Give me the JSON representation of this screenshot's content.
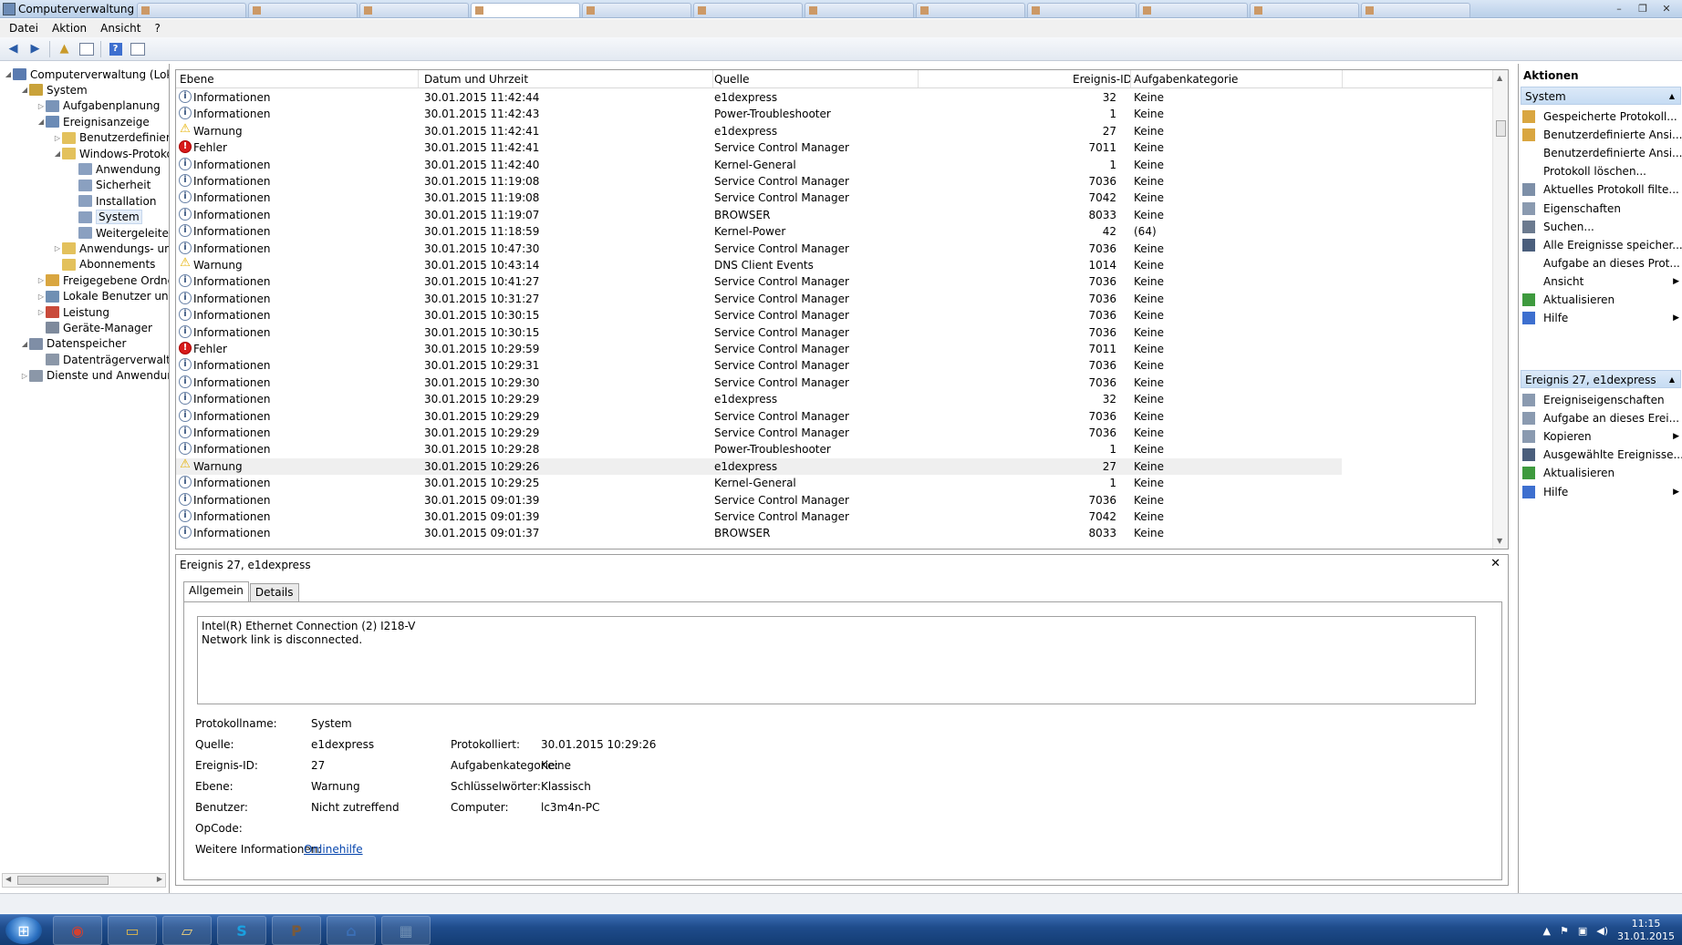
{
  "window": {
    "title": "Computerverwaltung"
  },
  "menu": [
    "Datei",
    "Aktion",
    "Ansicht",
    "?"
  ],
  "tree": [
    {
      "label": "Computerverwaltung (Lokal)",
      "icon": "computer-management-icon",
      "color": "#5a7bb0"
    },
    {
      "label": "System",
      "icon": "system-tools-icon",
      "color": "#c9a23a"
    },
    {
      "label": "Aufgabenplanung",
      "icon": "clock-icon",
      "color": "#7a94b8"
    },
    {
      "label": "Ereignisanzeige",
      "icon": "event-viewer-icon",
      "color": "#6b8bb6"
    },
    {
      "label": "Benutzerdefinierte A",
      "icon": "folder-icon",
      "color": "#e3c15c"
    },
    {
      "label": "Windows-Protokolle",
      "icon": "folder-icon",
      "color": "#e3c15c"
    },
    {
      "label": "Anwendung",
      "icon": "log-icon",
      "color": "#8aa0c0"
    },
    {
      "label": "Sicherheit",
      "icon": "log-icon",
      "color": "#8aa0c0"
    },
    {
      "label": "Installation",
      "icon": "log-icon",
      "color": "#8aa0c0"
    },
    {
      "label": "System",
      "icon": "log-icon",
      "color": "#8aa0c0"
    },
    {
      "label": "Weitergeleitete E",
      "icon": "log-icon",
      "color": "#8aa0c0"
    },
    {
      "label": "Anwendungs- und D",
      "icon": "folder-icon",
      "color": "#e3c15c"
    },
    {
      "label": "Abonnements",
      "icon": "subscriptions-icon",
      "color": "#e3c15c"
    },
    {
      "label": "Freigegebene Ordner",
      "icon": "shared-folder-icon",
      "color": "#d9a640"
    },
    {
      "label": "Lokale Benutzer und Gru",
      "icon": "users-icon",
      "color": "#6f8fb3"
    },
    {
      "label": "Leistung",
      "icon": "performance-icon",
      "color": "#c94a3a"
    },
    {
      "label": "Geräte-Manager",
      "icon": "device-manager-icon",
      "color": "#7e8a9c"
    },
    {
      "label": "Datenspeicher",
      "icon": "storage-icon",
      "color": "#7f8ea6"
    },
    {
      "label": "Datenträgerverwaltung",
      "icon": "disk-icon",
      "color": "#8b97a8"
    },
    {
      "label": "Dienste und Anwendungen",
      "icon": "services-icon",
      "color": "#8b97a8"
    }
  ],
  "grid": {
    "columns": [
      "Ebene",
      "Datum und Uhrzeit",
      "Quelle",
      "Ereignis-ID",
      "Aufgabenkategorie"
    ],
    "rows": [
      {
        "level": "Informationen",
        "type": "info",
        "date": "30.01.2015 11:42:44",
        "source": "e1dexpress",
        "id": "32",
        "cat": "Keine"
      },
      {
        "level": "Informationen",
        "type": "info",
        "date": "30.01.2015 11:42:43",
        "source": "Power-Troubleshooter",
        "id": "1",
        "cat": "Keine"
      },
      {
        "level": "Warnung",
        "type": "warn",
        "date": "30.01.2015 11:42:41",
        "source": "e1dexpress",
        "id": "27",
        "cat": "Keine"
      },
      {
        "level": "Fehler",
        "type": "err",
        "date": "30.01.2015 11:42:41",
        "source": "Service Control Manager",
        "id": "7011",
        "cat": "Keine"
      },
      {
        "level": "Informationen",
        "type": "info",
        "date": "30.01.2015 11:42:40",
        "source": "Kernel-General",
        "id": "1",
        "cat": "Keine"
      },
      {
        "level": "Informationen",
        "type": "info",
        "date": "30.01.2015 11:19:08",
        "source": "Service Control Manager",
        "id": "7036",
        "cat": "Keine"
      },
      {
        "level": "Informationen",
        "type": "info",
        "date": "30.01.2015 11:19:08",
        "source": "Service Control Manager",
        "id": "7042",
        "cat": "Keine"
      },
      {
        "level": "Informationen",
        "type": "info",
        "date": "30.01.2015 11:19:07",
        "source": "BROWSER",
        "id": "8033",
        "cat": "Keine"
      },
      {
        "level": "Informationen",
        "type": "info",
        "date": "30.01.2015 11:18:59",
        "source": "Kernel-Power",
        "id": "42",
        "cat": "(64)"
      },
      {
        "level": "Informationen",
        "type": "info",
        "date": "30.01.2015 10:47:30",
        "source": "Service Control Manager",
        "id": "7036",
        "cat": "Keine"
      },
      {
        "level": "Warnung",
        "type": "warn",
        "date": "30.01.2015 10:43:14",
        "source": "DNS Client Events",
        "id": "1014",
        "cat": "Keine"
      },
      {
        "level": "Informationen",
        "type": "info",
        "date": "30.01.2015 10:41:27",
        "source": "Service Control Manager",
        "id": "7036",
        "cat": "Keine"
      },
      {
        "level": "Informationen",
        "type": "info",
        "date": "30.01.2015 10:31:27",
        "source": "Service Control Manager",
        "id": "7036",
        "cat": "Keine"
      },
      {
        "level": "Informationen",
        "type": "info",
        "date": "30.01.2015 10:30:15",
        "source": "Service Control Manager",
        "id": "7036",
        "cat": "Keine"
      },
      {
        "level": "Informationen",
        "type": "info",
        "date": "30.01.2015 10:30:15",
        "source": "Service Control Manager",
        "id": "7036",
        "cat": "Keine"
      },
      {
        "level": "Fehler",
        "type": "err",
        "date": "30.01.2015 10:29:59",
        "source": "Service Control Manager",
        "id": "7011",
        "cat": "Keine"
      },
      {
        "level": "Informationen",
        "type": "info",
        "date": "30.01.2015 10:29:31",
        "source": "Service Control Manager",
        "id": "7036",
        "cat": "Keine"
      },
      {
        "level": "Informationen",
        "type": "info",
        "date": "30.01.2015 10:29:30",
        "source": "Service Control Manager",
        "id": "7036",
        "cat": "Keine"
      },
      {
        "level": "Informationen",
        "type": "info",
        "date": "30.01.2015 10:29:29",
        "source": "e1dexpress",
        "id": "32",
        "cat": "Keine"
      },
      {
        "level": "Informationen",
        "type": "info",
        "date": "30.01.2015 10:29:29",
        "source": "Service Control Manager",
        "id": "7036",
        "cat": "Keine"
      },
      {
        "level": "Informationen",
        "type": "info",
        "date": "30.01.2015 10:29:29",
        "source": "Service Control Manager",
        "id": "7036",
        "cat": "Keine"
      },
      {
        "level": "Informationen",
        "type": "info",
        "date": "30.01.2015 10:29:28",
        "source": "Power-Troubleshooter",
        "id": "1",
        "cat": "Keine"
      },
      {
        "level": "Warnung",
        "type": "warn",
        "date": "30.01.2015 10:29:26",
        "source": "e1dexpress",
        "id": "27",
        "cat": "Keine",
        "selected": true
      },
      {
        "level": "Informationen",
        "type": "info",
        "date": "30.01.2015 10:29:25",
        "source": "Kernel-General",
        "id": "1",
        "cat": "Keine"
      },
      {
        "level": "Informationen",
        "type": "info",
        "date": "30.01.2015 09:01:39",
        "source": "Service Control Manager",
        "id": "7036",
        "cat": "Keine"
      },
      {
        "level": "Informationen",
        "type": "info",
        "date": "30.01.2015 09:01:39",
        "source": "Service Control Manager",
        "id": "7042",
        "cat": "Keine"
      },
      {
        "level": "Informationen",
        "type": "info",
        "date": "30.01.2015 09:01:37",
        "source": "BROWSER",
        "id": "8033",
        "cat": "Keine"
      }
    ]
  },
  "detail": {
    "title": "Ereignis 27, e1dexpress",
    "tabs": [
      "Allgemein",
      "Details"
    ],
    "message_line1": "Intel(R) Ethernet Connection (2) I218-V",
    "message_line2": "Network link is disconnected.",
    "fields": {
      "protokollname_label": "Protokollname:",
      "protokollname": "System",
      "quelle_label": "Quelle:",
      "quelle": "e1dexpress",
      "protokolliert_label": "Protokolliert:",
      "protokolliert": "30.01.2015 10:29:26",
      "id_label": "Ereignis-ID:",
      "id": "27",
      "aufgabe_label": "Aufgabenkategorie:",
      "aufgabe": "Keine",
      "ebene_label": "Ebene:",
      "ebene": "Warnung",
      "schluessel_label": "Schlüsselwörter:",
      "schluessel": "Klassisch",
      "benutzer_label": "Benutzer:",
      "benutzer": "Nicht zutreffend",
      "computer_label": "Computer:",
      "computer": "lc3m4n-PC",
      "opcode_label": "OpCode:",
      "weitere_label": "Weitere Informationen:",
      "weitere_link": "Onlinehilfe"
    }
  },
  "actions": {
    "title": "Aktionen",
    "group1": "System",
    "group1_items": [
      {
        "label": "Gespeicherte Protokoll...",
        "icon": "open-log-icon",
        "color": "#d9a640",
        "submenu": false
      },
      {
        "label": "Benutzerdefinierte Ansi...",
        "icon": "filter-icon",
        "color": "#d9a640",
        "submenu": false
      },
      {
        "label": "Benutzerdefinierte Ansi...",
        "icon": "blank-icon",
        "color": "",
        "submenu": false
      },
      {
        "label": "Protokoll löschen...",
        "icon": "blank-icon",
        "color": "",
        "submenu": false
      },
      {
        "label": "Aktuelles Protokoll filte...",
        "icon": "filter-icon",
        "color": "#7d8fa8",
        "submenu": false
      },
      {
        "label": "Eigenschaften",
        "icon": "properties-icon",
        "color": "#8a9ab0",
        "submenu": false
      },
      {
        "label": "Suchen...",
        "icon": "find-icon",
        "color": "#6b7a8f",
        "submenu": false
      },
      {
        "label": "Alle Ereignisse speicher...",
        "icon": "save-icon",
        "color": "#4a5e7c",
        "submenu": false
      },
      {
        "label": "Aufgabe an dieses Prot...",
        "icon": "blank-icon",
        "color": "",
        "submenu": false
      },
      {
        "label": "Ansicht",
        "icon": "blank-icon",
        "color": "",
        "submenu": true
      },
      {
        "label": "Aktualisieren",
        "icon": "refresh-icon",
        "color": "#3e9a3e",
        "submenu": false
      },
      {
        "label": "Hilfe",
        "icon": "help-icon",
        "color": "#3d6fcf",
        "submenu": true
      }
    ],
    "group2": "Ereignis 27, e1dexpress",
    "group2_items": [
      {
        "label": "Ereigniseigenschaften",
        "icon": "properties-icon",
        "color": "#8a9ab0",
        "submenu": false
      },
      {
        "label": "Aufgabe an dieses Erei...",
        "icon": "task-icon",
        "color": "#8a9ab0",
        "submenu": false
      },
      {
        "label": "Kopieren",
        "icon": "copy-icon",
        "color": "#8a9ab0",
        "submenu": true
      },
      {
        "label": "Ausgewählte Ereignisse...",
        "icon": "save-icon",
        "color": "#4a5e7c",
        "submenu": false
      },
      {
        "label": "Aktualisieren",
        "icon": "refresh-icon",
        "color": "#3e9a3e",
        "submenu": false
      },
      {
        "label": "Hilfe",
        "icon": "help-icon",
        "color": "#3d6fcf",
        "submenu": true
      }
    ]
  },
  "taskbar": {
    "apps": [
      {
        "name": "chrome-icon",
        "glyph": "◉",
        "color": "#d4402f"
      },
      {
        "name": "explorer-icon",
        "glyph": "▭",
        "color": "#e1b94a"
      },
      {
        "name": "folder-icon",
        "glyph": "▱",
        "color": "#f1d27a"
      },
      {
        "name": "skype-icon",
        "glyph": "S",
        "color": "#1aa0e0"
      },
      {
        "name": "poe-icon",
        "glyph": "P",
        "color": "#7a5a3a"
      },
      {
        "name": "network-app-icon",
        "glyph": "⌂",
        "color": "#3b6fb6"
      },
      {
        "name": "computer-management-icon",
        "glyph": "▦",
        "color": "#6f8fb3"
      }
    ],
    "time": "11:15",
    "date": "31.01.2015"
  }
}
